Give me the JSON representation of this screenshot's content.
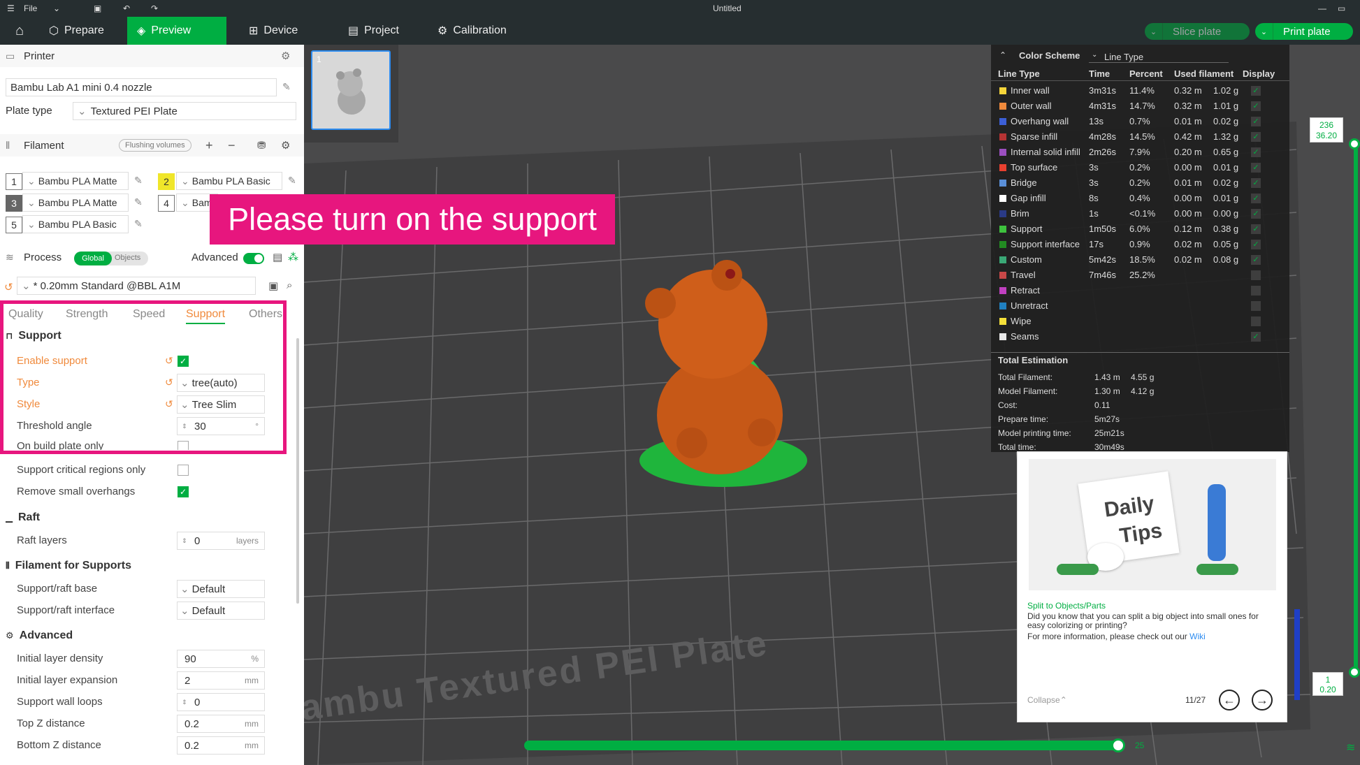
{
  "titlebar": {
    "file": "File",
    "title": "Untitled"
  },
  "tabs": {
    "prepare": "Prepare",
    "preview": "Preview",
    "device": "Device",
    "project": "Project",
    "calibration": "Calibration"
  },
  "buttons": {
    "slice": "Slice plate",
    "print": "Print plate"
  },
  "printer": {
    "title": "Printer",
    "value": "Bambu Lab A1 mini 0.4 nozzle",
    "plate_label": "Plate type",
    "plate_value": "Textured PEI Plate"
  },
  "filament": {
    "title": "Filament",
    "flush": "Flushing volumes",
    "items": [
      {
        "num": "1",
        "name": "Bambu PLA Matte"
      },
      {
        "num": "2",
        "name": "Bambu PLA Basic"
      },
      {
        "num": "3",
        "name": "Bambu PLA Matte"
      },
      {
        "num": "4",
        "name": "Bam"
      },
      {
        "num": "5",
        "name": "Bambu PLA Basic"
      }
    ]
  },
  "process": {
    "title": "Process",
    "global": "Global",
    "objects": "Objects",
    "advanced": "Advanced",
    "profile": "* 0.20mm Standard @BBL A1M",
    "tabs": [
      "Quality",
      "Strength",
      "Speed",
      "Support",
      "Others"
    ]
  },
  "support": {
    "header": "Support",
    "enable": "Enable support",
    "type": "Type",
    "type_val": "tree(auto)",
    "style": "Style",
    "style_val": "Tree Slim",
    "threshold": "Threshold angle",
    "threshold_val": "30",
    "build_plate": "On build plate only",
    "critical": "Support critical regions only",
    "remove_small": "Remove small overhangs"
  },
  "raft": {
    "header": "Raft",
    "layers": "Raft layers",
    "layers_val": "0",
    "unit": "layers"
  },
  "fil_support": {
    "header": "Filament for Supports",
    "base": "Support/raft base",
    "base_val": "Default",
    "interface": "Support/raft interface",
    "interface_val": "Default"
  },
  "advanced": {
    "header": "Advanced",
    "density": "Initial layer density",
    "density_val": "90",
    "density_unit": "%",
    "expansion": "Initial layer expansion",
    "expansion_val": "2",
    "mm": "mm",
    "walls": "Support wall loops",
    "walls_val": "0",
    "top_z": "Top Z distance",
    "top_z_val": "0.2",
    "bottom_z": "Bottom Z distance",
    "bottom_z_val": "0.2"
  },
  "banner": "Please turn on the support",
  "legend": {
    "title": "Color Scheme",
    "scheme": "Line Type",
    "headers": [
      "Line Type",
      "Time",
      "Percent",
      "Used filament",
      "Display"
    ],
    "rows": [
      {
        "name": "Inner wall",
        "color": "#f5d53a",
        "time": "3m31s",
        "pct": "11.4%",
        "m": "0.32 m",
        "g": "1.02 g",
        "on": true
      },
      {
        "name": "Outer wall",
        "color": "#f08a3c",
        "time": "4m31s",
        "pct": "14.7%",
        "m": "0.32 m",
        "g": "1.01 g",
        "on": true
      },
      {
        "name": "Overhang wall",
        "color": "#3c5fd6",
        "time": "13s",
        "pct": "0.7%",
        "m": "0.01 m",
        "g": "0.02 g",
        "on": true
      },
      {
        "name": "Sparse infill",
        "color": "#b53333",
        "time": "4m28s",
        "pct": "14.5%",
        "m": "0.42 m",
        "g": "1.32 g",
        "on": true
      },
      {
        "name": "Internal solid infill",
        "color": "#9b4fc0",
        "time": "2m26s",
        "pct": "7.9%",
        "m": "0.20 m",
        "g": "0.65 g",
        "on": true
      },
      {
        "name": "Top surface",
        "color": "#e8402f",
        "time": "3s",
        "pct": "0.2%",
        "m": "0.00 m",
        "g": "0.01 g",
        "on": true
      },
      {
        "name": "Bridge",
        "color": "#5a8fd8",
        "time": "3s",
        "pct": "0.2%",
        "m": "0.01 m",
        "g": "0.02 g",
        "on": true
      },
      {
        "name": "Gap infill",
        "color": "#ffffff",
        "time": "8s",
        "pct": "0.4%",
        "m": "0.00 m",
        "g": "0.01 g",
        "on": true
      },
      {
        "name": "Brim",
        "color": "#2a3a86",
        "time": "1s",
        "pct": "<0.1%",
        "m": "0.00 m",
        "g": "0.00 g",
        "on": true
      },
      {
        "name": "Support",
        "color": "#3ec23e",
        "time": "1m50s",
        "pct": "6.0%",
        "m": "0.12 m",
        "g": "0.38 g",
        "on": true
      },
      {
        "name": "Support interface",
        "color": "#228b22",
        "time": "17s",
        "pct": "0.9%",
        "m": "0.02 m",
        "g": "0.05 g",
        "on": true
      },
      {
        "name": "Custom",
        "color": "#3aa876",
        "time": "5m42s",
        "pct": "18.5%",
        "m": "0.02 m",
        "g": "0.08 g",
        "on": true
      },
      {
        "name": "Travel",
        "color": "#c84848",
        "time": "7m46s",
        "pct": "25.2%",
        "m": "",
        "g": "",
        "on": false
      },
      {
        "name": "Retract",
        "color": "#c040c0",
        "time": "",
        "pct": "",
        "m": "",
        "g": "",
        "on": false
      },
      {
        "name": "Unretract",
        "color": "#2080c0",
        "time": "",
        "pct": "",
        "m": "",
        "g": "",
        "on": false
      },
      {
        "name": "Wipe",
        "color": "#f5e03a",
        "time": "",
        "pct": "",
        "m": "",
        "g": "",
        "on": false
      },
      {
        "name": "Seams",
        "color": "#e8e8e8",
        "time": "",
        "pct": "",
        "m": "",
        "g": "",
        "on": true
      }
    ],
    "total_title": "Total Estimation",
    "totals": [
      {
        "k": "Total Filament:",
        "v": "1.43 m",
        "v2": "4.55 g"
      },
      {
        "k": "Model Filament:",
        "v": "1.30 m",
        "v2": "4.12 g"
      },
      {
        "k": "Cost:",
        "v": "0.11",
        "v2": ""
      },
      {
        "k": "Prepare time:",
        "v": "5m27s",
        "v2": ""
      },
      {
        "k": "Model printing time:",
        "v": "25m21s",
        "v2": ""
      },
      {
        "k": "Total time:",
        "v": "30m49s",
        "v2": ""
      }
    ]
  },
  "tips": {
    "img_line1": "Daily",
    "img_line2": "Tips",
    "heading": "Split to Objects/Parts",
    "body": "Did you know that you can split a big object into small ones for easy colorizing or printing?",
    "more": "For more information, please check out our",
    "wiki": "Wiki",
    "collapse": "Collapse",
    "page": "11/27"
  },
  "layers": {
    "top_layer": "236",
    "top_height": "36.20",
    "bottom_layer": "1",
    "bottom_height": "0.20",
    "moves": "25"
  },
  "plate_label": "ambu Textured PEI Plate",
  "plate_number": "1",
  "colors": {
    "accent": "#00ae42",
    "highlight": "#e7167e",
    "orange": "#f08a3c"
  }
}
